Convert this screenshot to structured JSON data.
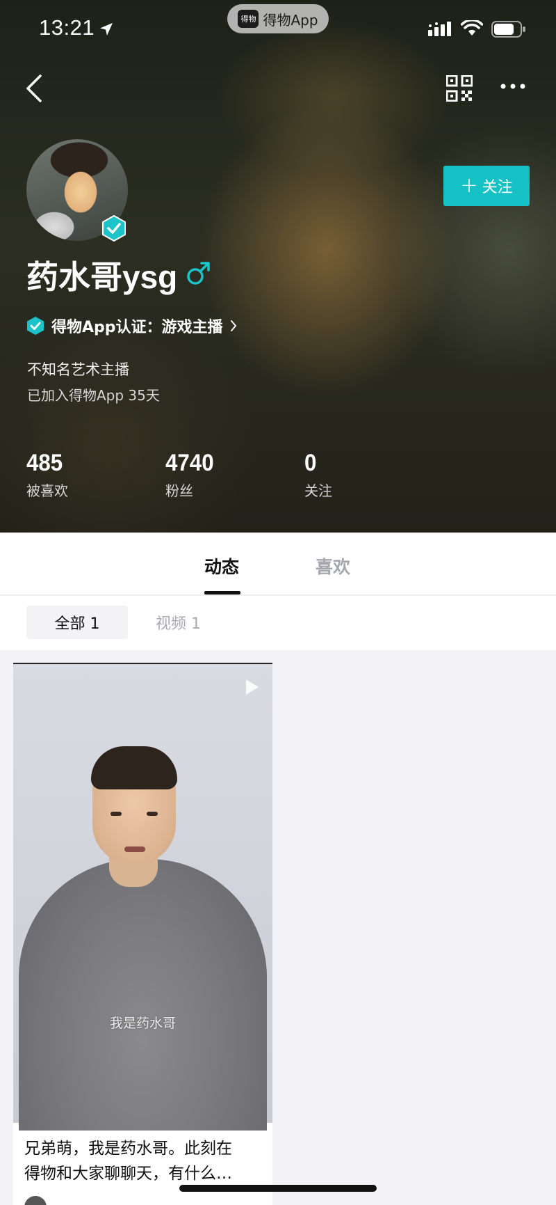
{
  "status_bar": {
    "time": "13:21",
    "app_pill_logo": "得物",
    "app_pill_name": "得物App",
    "icons": [
      "location-arrow-icon",
      "signal-icon",
      "wifi-icon",
      "battery-icon"
    ]
  },
  "nav": {
    "icons": [
      "back-icon",
      "qr-code-icon",
      "more-icon"
    ]
  },
  "profile": {
    "name": "药水哥ysg",
    "gender_icon": "male-icon",
    "follow_label": "关注",
    "certification": "得物App认证：游戏主播",
    "bio": "不知名艺术主播",
    "joined": "已加入得物App 35天",
    "accent_color": "#16c1c6"
  },
  "stats": [
    {
      "value": "485",
      "label": "被喜欢"
    },
    {
      "value": "4740",
      "label": "粉丝"
    },
    {
      "value": "0",
      "label": "关注"
    }
  ],
  "tabs": [
    {
      "label": "动态",
      "active": true
    },
    {
      "label": "喜欢",
      "active": false
    }
  ],
  "filters": [
    {
      "label": "全部 1",
      "active": true
    },
    {
      "label": "视频 1",
      "active": false
    }
  ],
  "posts": [
    {
      "subtitle": "我是药水哥",
      "caption_line1": "兄弟萌，我是药水哥。此刻在",
      "caption_line2": "得物和大家聊聊天，有什么…"
    }
  ]
}
